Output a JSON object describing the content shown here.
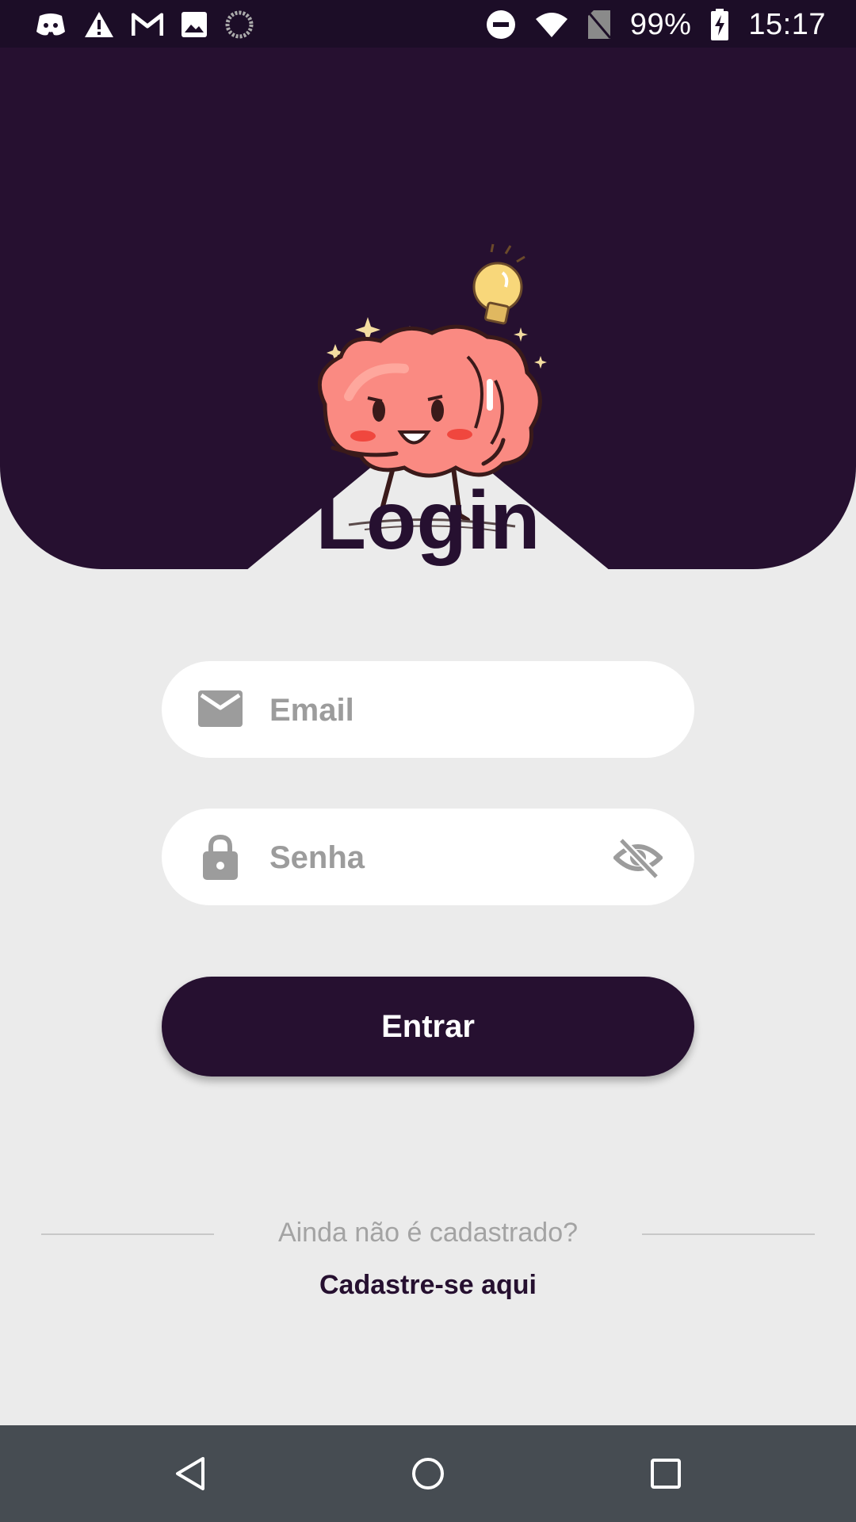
{
  "status_bar": {
    "battery": "99%",
    "time": "15:17",
    "left_icons": [
      "discord-icon",
      "warning-icon",
      "gmail-icon",
      "image-icon",
      "loading-icon"
    ],
    "right_icons": [
      "do-not-disturb-icon",
      "wifi-icon",
      "no-sim-icon",
      "battery-charging-icon"
    ]
  },
  "header": {
    "title": "Login",
    "mascot": "brain-lightbulb-mascot"
  },
  "form": {
    "email_placeholder": "Email",
    "password_placeholder": "Senha",
    "submit_label": "Entrar"
  },
  "signup": {
    "question": "Ainda não é cadastrado?",
    "link": "Cadastre-se aqui"
  },
  "nav_bar": {
    "buttons": [
      "back-icon",
      "home-icon",
      "recents-icon"
    ]
  },
  "colors": {
    "primary": "#261030",
    "background": "#ebebeb",
    "mascot_pink": "#fa8a82",
    "bulb_yellow": "#f8d77a",
    "placeholder": "#9c9c9c"
  }
}
